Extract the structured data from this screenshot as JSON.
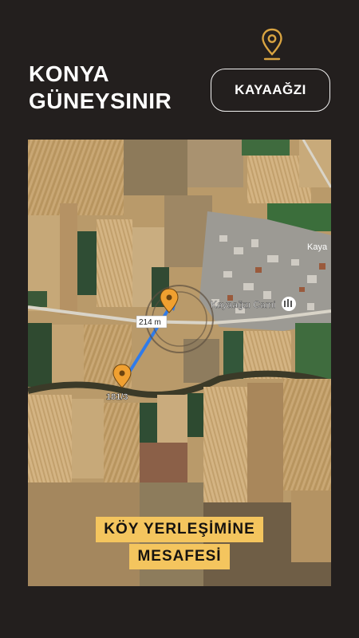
{
  "header": {
    "title_line1": "KONYA",
    "title_line2": "GÜNEYSINIR",
    "location_label": "KAYAAĞZI",
    "pin_icon": "location-pin-icon",
    "accent_color": "#d9a441"
  },
  "map": {
    "mosque_label": "Kayaağzı Cami",
    "village_label_partial": "Kaya",
    "distance_label": "214 m",
    "parcel_label": "181/3",
    "marker_color": "#f0a030",
    "route_color": "#2f7bea"
  },
  "caption": {
    "line1": "KÖY YERLEŞİMİNE",
    "line2": "MESAFESİ",
    "background_color": "#f4c55e"
  }
}
